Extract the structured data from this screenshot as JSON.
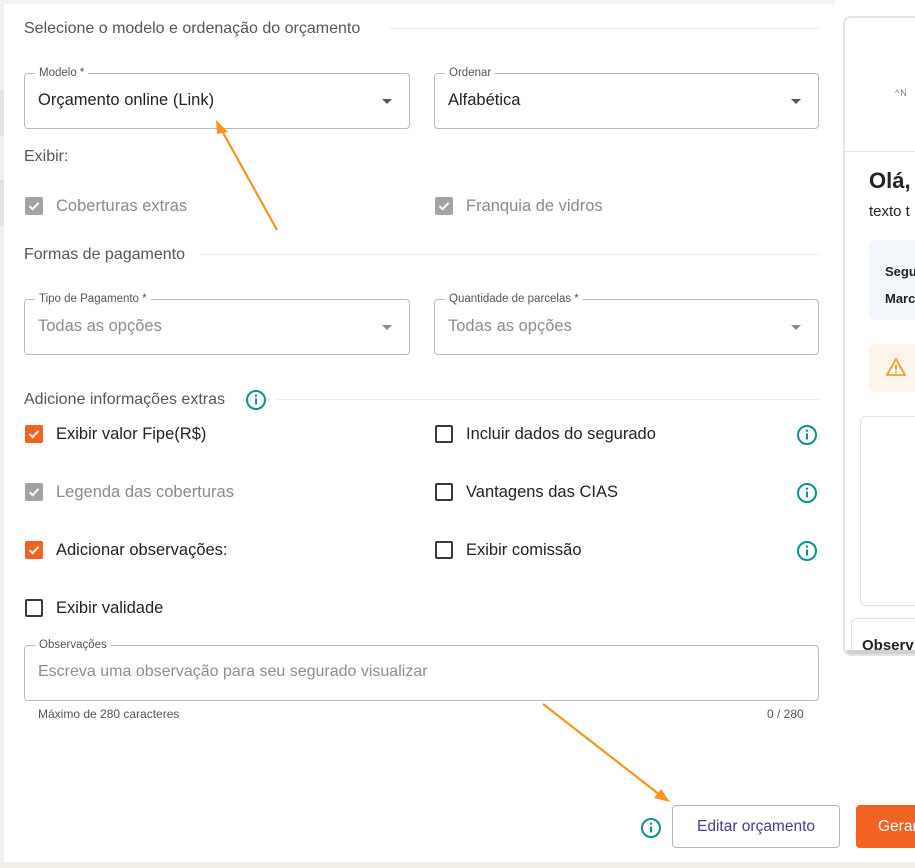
{
  "layout_section": {
    "title": "Selecione o modelo e ordenação do orçamento",
    "modelo": {
      "label": "Modelo *",
      "value": "Orçamento online (Link)"
    },
    "ordenar": {
      "label": "Ordenar",
      "value": "Alfabética"
    },
    "exibir_label": "Exibir:",
    "exibir_options": [
      {
        "label": "Coberturas extras",
        "checked": true,
        "disabled": true
      },
      {
        "label": "Franquia de vidros",
        "checked": true,
        "disabled": true
      }
    ]
  },
  "payment_section": {
    "title": "Formas de pagamento",
    "tipo_pagamento": {
      "label": "Tipo de Pagamento *",
      "placeholder": "Todas as opções"
    },
    "parcelas": {
      "label": "Quantidade de parcelas *",
      "placeholder": "Todas as opções"
    }
  },
  "extras_section": {
    "title": "Adicione informações extras",
    "options": [
      {
        "label": "Exibir valor Fipe(R$)",
        "checked": true,
        "disabled": false
      },
      {
        "label": "Incluir dados do segurado",
        "checked": false,
        "disabled": false
      },
      {
        "label": "Legenda das coberturas",
        "checked": true,
        "disabled": true
      },
      {
        "label": "Vantagens das CIAS",
        "checked": false,
        "disabled": false
      },
      {
        "label": "Adicionar observações:",
        "checked": true,
        "disabled": false
      },
      {
        "label": "Exibir comissão",
        "checked": false,
        "disabled": false
      },
      {
        "label": "Exibir validade",
        "checked": false,
        "disabled": false
      }
    ],
    "observacoes": {
      "label": "Observações",
      "placeholder": "Escreva uma observação para seu segurado visualizar",
      "helper": "Máximo de 280 caracteres",
      "counter": "0 / 280"
    }
  },
  "actions": {
    "edit_label": "Editar orçamento",
    "primary_label": "Gerar"
  },
  "preview": {
    "logo_text": "^N",
    "greeting": "Olá,",
    "subtitle": "texto t",
    "info_line1": "Segu",
    "info_line2": "Marc",
    "obs_title": "Observ"
  },
  "colors": {
    "accent_orange": "#f26322",
    "info_teal": "#0f8f8f",
    "button_purple": "#4b3a8f",
    "arrow_orange": "#f7931e"
  },
  "icons": {
    "info": "info-circle-icon",
    "warning": "warning-triangle-icon",
    "dropdown": "caret-down-icon",
    "check": "checkmark-icon"
  }
}
